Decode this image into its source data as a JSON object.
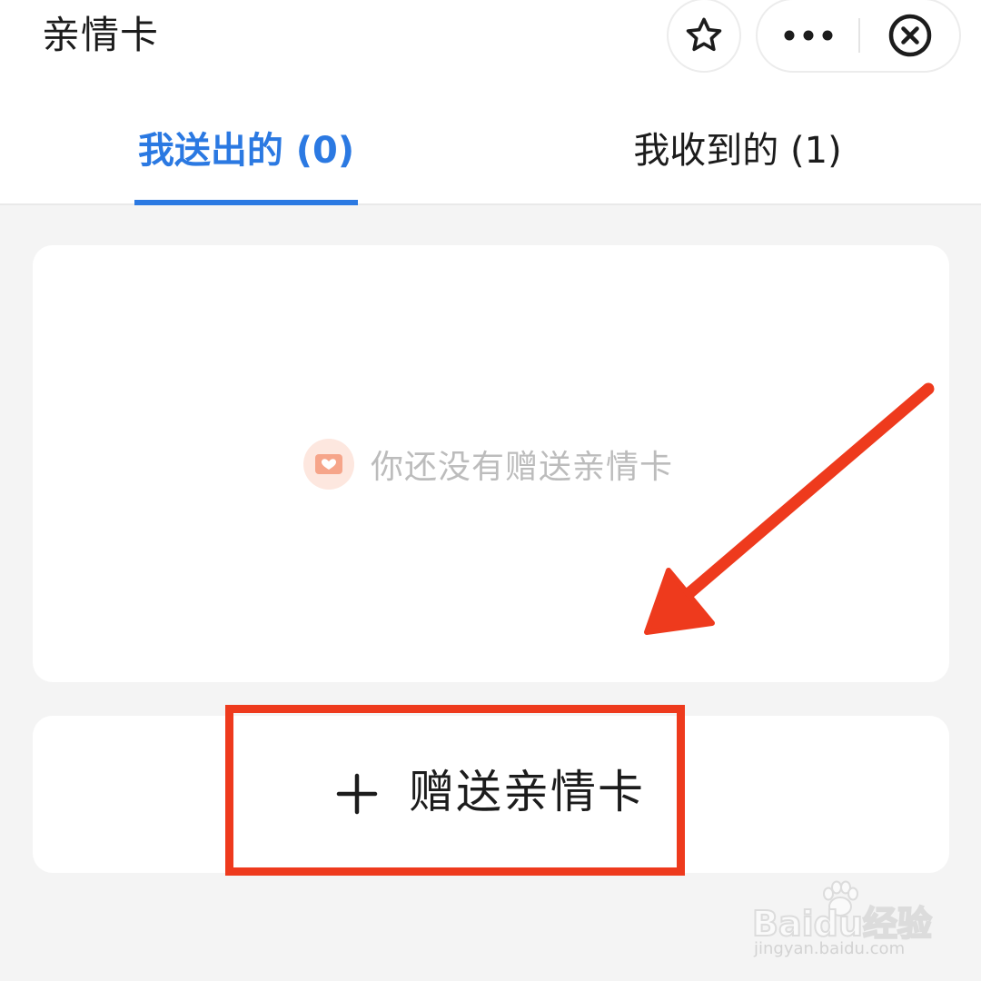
{
  "header": {
    "title": "亲情卡",
    "icons": {
      "star": "star-icon",
      "more": "more-dots-icon",
      "close": "close-circle-icon"
    }
  },
  "tabs": [
    {
      "label": "我送出的 (0)",
      "active": true
    },
    {
      "label": "我收到的 (1)",
      "active": false
    }
  ],
  "empty_state": {
    "icon": "gift-card-icon",
    "text": "你还没有赠送亲情卡"
  },
  "gift_button": {
    "icon": "plus-icon",
    "label": "赠送亲情卡"
  },
  "annotations": {
    "arrow_color": "#ee3a1d",
    "box_color": "#ee3a1d"
  },
  "watermark": {
    "brand": "Baidu经验",
    "url": "jingyan.baidu.com"
  },
  "colors": {
    "accent": "#2b79e2",
    "background": "#f4f4f4",
    "card": "#ffffff"
  }
}
